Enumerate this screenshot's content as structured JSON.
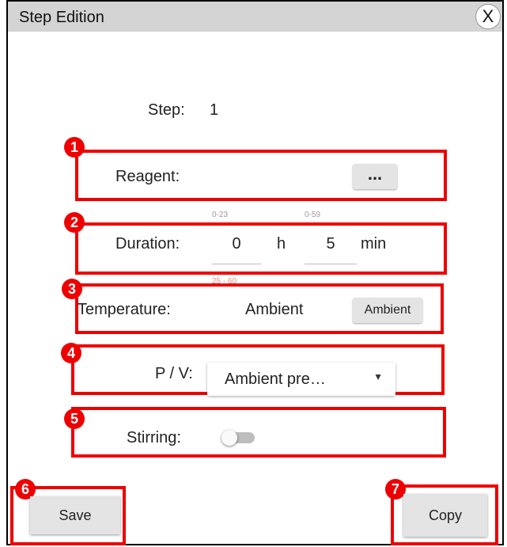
{
  "dialog": {
    "title": "Step Edition",
    "close_label": "X"
  },
  "step": {
    "label": "Step:",
    "value": "1"
  },
  "reagent": {
    "marker": "1",
    "label": "Reagent:",
    "button_label": "..."
  },
  "duration": {
    "marker": "2",
    "label": "Duration:",
    "hours_range": "0-23",
    "hours_value": "0",
    "hours_unit": "h",
    "minutes_range": "0-59",
    "minutes_value": "5",
    "minutes_unit": "min"
  },
  "temperature": {
    "marker": "3",
    "label": "Temperature:",
    "range": "25 - 60",
    "value": "Ambient",
    "button_label": "Ambient"
  },
  "pv": {
    "marker": "4",
    "label": "P / V:",
    "selected": "Ambient pre…"
  },
  "stirring": {
    "marker": "5",
    "label": "Stirring:",
    "enabled": false
  },
  "actions": {
    "save_marker": "6",
    "save_label": "Save",
    "copy_marker": "7",
    "copy_label": "Copy"
  },
  "colors": {
    "annotation": "#ee0000",
    "titlebar": "#d4d4d4",
    "button": "#e4e4e4"
  }
}
